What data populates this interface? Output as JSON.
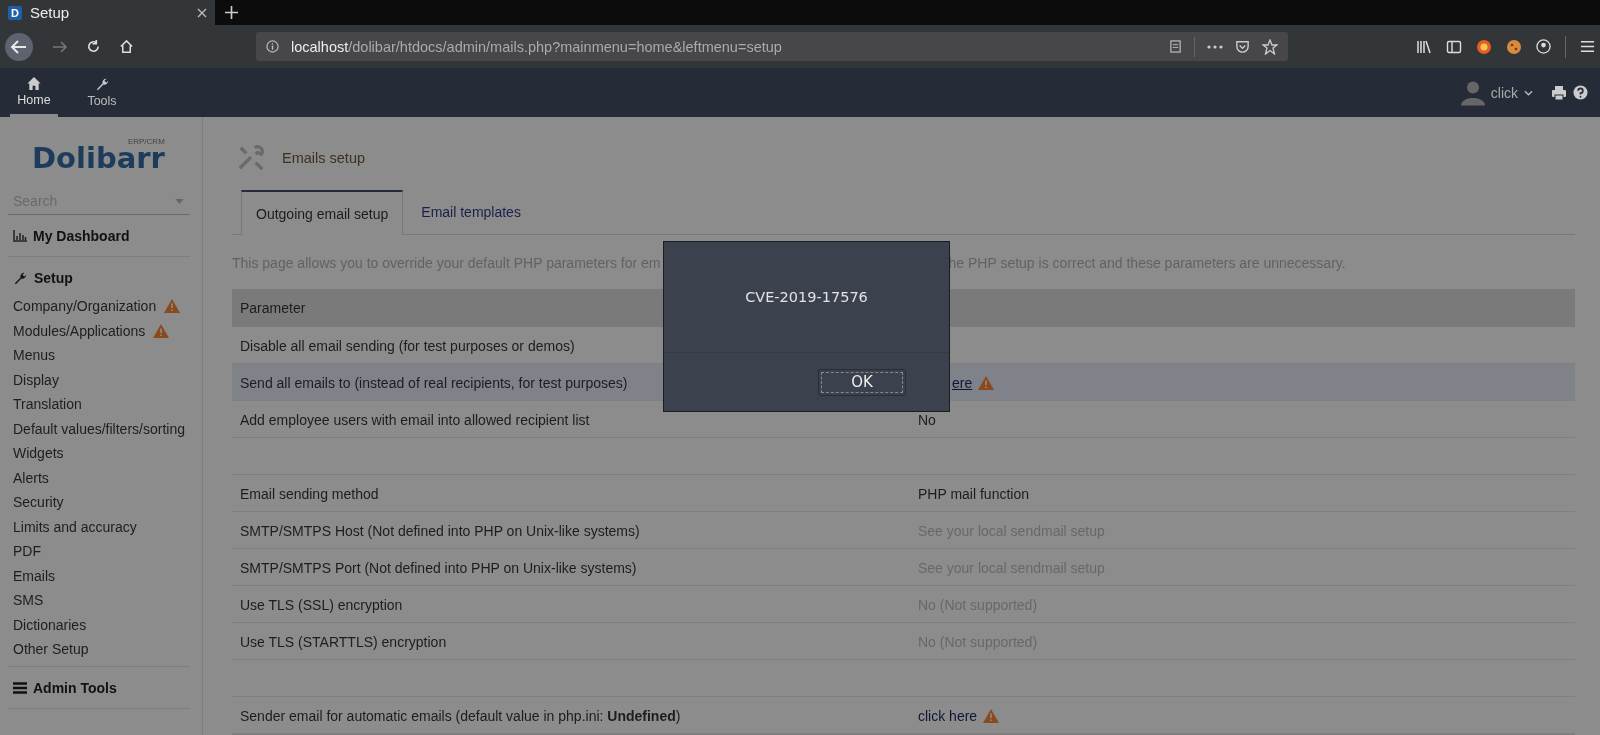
{
  "browser": {
    "tab": {
      "title": "Setup",
      "favicon": "D"
    },
    "url": {
      "host": "localhost",
      "path": "/dolibar/htdocs/admin/mails.php?mainmenu=home&leftmenu=setup"
    }
  },
  "topbar": {
    "menus": [
      {
        "label": "Home",
        "selected": true
      },
      {
        "label": "Tools",
        "selected": false
      }
    ],
    "user": "click"
  },
  "sidebar": {
    "logo": {
      "name": "Dolibarr",
      "tag": "ERP/CRM"
    },
    "search": {
      "placeholder": "Search"
    },
    "sections": [
      {
        "title": "My Dashboard"
      },
      {
        "title": "Setup",
        "items": [
          {
            "label": "Company/Organization",
            "warning": true
          },
          {
            "label": "Modules/Applications",
            "warning": true
          },
          {
            "label": "Menus",
            "warning": false
          },
          {
            "label": "Display",
            "warning": false
          },
          {
            "label": "Translation",
            "warning": false
          },
          {
            "label": "Default values/filters/sorting",
            "warning": false
          },
          {
            "label": "Widgets",
            "warning": false
          },
          {
            "label": "Alerts",
            "warning": false
          },
          {
            "label": "Security",
            "warning": false
          },
          {
            "label": "Limits and accuracy",
            "warning": false
          },
          {
            "label": "PDF",
            "warning": false
          },
          {
            "label": "Emails",
            "warning": false
          },
          {
            "label": "SMS",
            "warning": false
          },
          {
            "label": "Dictionaries",
            "warning": false
          },
          {
            "label": "Other Setup",
            "warning": false
          }
        ]
      },
      {
        "title": "Admin Tools"
      }
    ]
  },
  "page": {
    "title": "Emails setup",
    "tabs": [
      {
        "label": "Outgoing email setup",
        "selected": true
      },
      {
        "label": "Email templates",
        "selected": false
      }
    ],
    "description": {
      "before_dialog": "This page allows you to override your default PHP parameters for em",
      "after_dialog": "he PHP setup is correct and these parameters are unnecessary."
    },
    "table": {
      "header": "Parameter",
      "rows": [
        {
          "kind": "param",
          "label": "Disable all email sending (for test purposes or demos)",
          "highlighted": false
        },
        {
          "kind": "param",
          "label": "Send all emails to (instead of real recipients, for test purposes)",
          "value": "ere",
          "link": true,
          "underline": true,
          "warning": true,
          "partly_hidden": true,
          "highlighted": true
        },
        {
          "kind": "param",
          "label": "Add employee users with email into allowed recipient list",
          "value": "No",
          "link": false,
          "muted": false,
          "warning": false,
          "highlighted": false
        },
        {
          "kind": "spacer"
        },
        {
          "kind": "param",
          "label": "Email sending method",
          "value": "PHP mail function",
          "link": false,
          "muted": false,
          "warning": false,
          "highlighted": false
        },
        {
          "kind": "param",
          "label": "SMTP/SMTPS Host (Not defined into PHP on Unix-like systems)",
          "value": "See your local sendmail setup",
          "link": false,
          "muted": true,
          "warning": false,
          "highlighted": false
        },
        {
          "kind": "param",
          "label": "SMTP/SMTPS Port (Not defined into PHP on Unix-like systems)",
          "value": "See your local sendmail setup",
          "link": false,
          "muted": true,
          "warning": false,
          "highlighted": false
        },
        {
          "kind": "param",
          "label": "Use TLS (SSL) encryption",
          "value": "No (Not supported)",
          "link": false,
          "muted": true,
          "warning": false,
          "highlighted": false
        },
        {
          "kind": "param",
          "label": "Use TLS (STARTTLS) encryption",
          "value": "No (Not supported)",
          "link": false,
          "muted": true,
          "warning": false,
          "highlighted": false
        },
        {
          "kind": "spacer"
        },
        {
          "kind": "param",
          "label": "Sender email for automatic emails (default value in php.ini: **Undefined**)",
          "value": "click here",
          "link": true,
          "underline": false,
          "warning": true,
          "highlighted": false
        }
      ]
    }
  },
  "dialog": {
    "message": "CVE-2019-17576",
    "button": "OK"
  }
}
